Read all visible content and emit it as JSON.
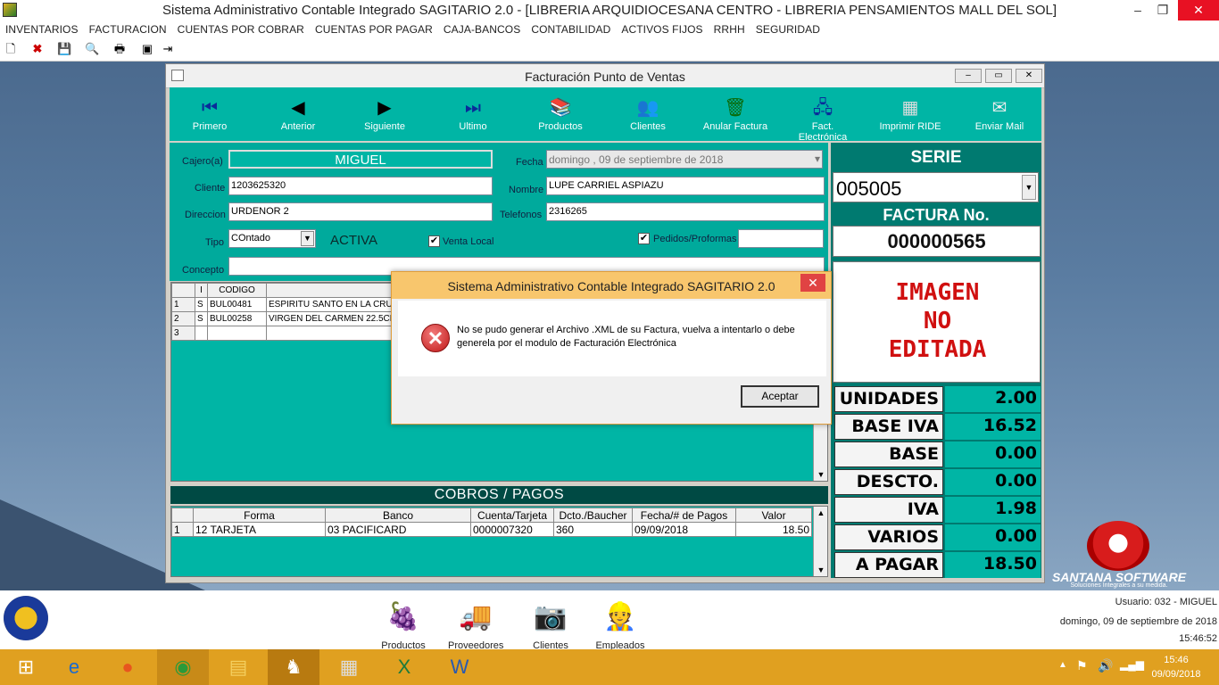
{
  "app": {
    "title": "Sistema Administrativo Contable Integrado SAGITARIO 2.0 - [LIBRERIA ARQUIDIOCESANA CENTRO - LIBRERIA PENSAMIENTOS MALL DEL SOL]",
    "minimize": "–",
    "restore": "❐",
    "close": "✕"
  },
  "menu": [
    "INVENTARIOS",
    "FACTURACION",
    "CUENTAS POR COBRAR",
    "CUENTAS POR PAGAR",
    "CAJA-BANCOS",
    "CONTABILIDAD",
    "ACTIVOS FIJOS",
    "RRHH",
    "SEGURIDAD"
  ],
  "child": {
    "title": "Facturación Punto de Ventas"
  },
  "nav": [
    {
      "label": "Primero",
      "icon": "first-icon",
      "glyph": "⏮"
    },
    {
      "label": "Anterior",
      "icon": "prev-icon",
      "glyph": "◀"
    },
    {
      "label": "Siguiente",
      "icon": "next-icon",
      "glyph": "▶"
    },
    {
      "label": "Ultimo",
      "icon": "last-icon",
      "glyph": "⏭"
    },
    {
      "label": "Productos",
      "icon": "books-icon",
      "glyph": "📚"
    },
    {
      "label": "Clientes",
      "icon": "people-icon",
      "glyph": "👥"
    },
    {
      "label": "Anular Factura",
      "icon": "trash-icon",
      "glyph": "🗑"
    },
    {
      "label": "Fact. Electrónica",
      "icon": "network-icon",
      "glyph": "🖧"
    },
    {
      "label": "Imprimir RIDE",
      "icon": "print-icon",
      "glyph": "▦"
    },
    {
      "label": "Enviar Mail",
      "icon": "mail-icon",
      "glyph": "✉"
    }
  ],
  "form": {
    "cajero_label": "Cajero(a)",
    "cajero": "MIGUEL",
    "fecha_label": "Fecha",
    "fecha": "domingo , 09 de septiembre de 2018",
    "cliente_label": "Cliente",
    "cliente": "1203625320",
    "nombre_label": "Nombre",
    "nombre": "LUPE CARRIEL ASPIAZU",
    "direccion_label": "Direccion",
    "direccion": "URDENOR 2",
    "telefonos_label": "Telefonos",
    "telefonos": "2316265",
    "tipo_label": "Tipo",
    "tipo": "COntado",
    "estado": "ACTIVA",
    "venta_local": "Venta Local",
    "pedidos": "Pedidos/Proformas",
    "concepto_label": "Concepto"
  },
  "items": {
    "headers": [
      "",
      "I",
      "CODIGO",
      ""
    ],
    "rows": [
      [
        "1",
        "S",
        "BUL00481",
        "ESPIRITU SANTO EN LA CRU"
      ],
      [
        "2",
        "S",
        "BUL00258",
        "VIRGEN DEL CARMEN 22.5CM"
      ],
      [
        "3",
        "",
        "",
        ""
      ]
    ]
  },
  "cobros": {
    "title": "COBROS  /  PAGOS",
    "headers": [
      "",
      "Forma",
      "Banco",
      "Cuenta/Tarjeta",
      "Dcto./Baucher",
      "Fecha/# de Pagos",
      "Valor"
    ],
    "rows": [
      [
        "1",
        "12 TARJETA",
        "03 PACIFICARD",
        "0000007320",
        "360",
        "09/09/2018",
        "18.50"
      ]
    ]
  },
  "right": {
    "serie_label": "SERIE",
    "serie": "005005",
    "factura_label": "FACTURA No.",
    "factura": "000000565",
    "imagen": [
      "IMAGEN",
      "NO",
      "EDITADA"
    ],
    "totals": [
      {
        "k": "UNIDADES",
        "v": "2.00"
      },
      {
        "k": "BASE IVA",
        "v": "16.52"
      },
      {
        "k": "BASE CERO",
        "v": "0.00"
      },
      {
        "k": "DESCTO.",
        "v": "0.00"
      },
      {
        "k": "IVA",
        "v": "1.98"
      },
      {
        "k": "VARIOS",
        "v": "0.00"
      },
      {
        "k": "A PAGAR",
        "v": "18.50"
      }
    ]
  },
  "dialog": {
    "title": "Sistema Administrativo Contable Integrado SAGITARIO 2.0",
    "message": "No se pudo generar el Archivo .XML de su Factura, vuelva a intentarlo o debe generela por el modulo de Facturación Electrónica",
    "ok": "Aceptar",
    "close": "✕"
  },
  "dock": [
    {
      "label": "Productos",
      "icon": "raspberry-icon",
      "glyph": "🍇"
    },
    {
      "label": "Proveedores",
      "icon": "truck-icon",
      "glyph": "🚚"
    },
    {
      "label": "Clientes",
      "icon": "webcam-icon",
      "glyph": "📷"
    },
    {
      "label": "Empleados",
      "icon": "worker-icon",
      "glyph": "👷"
    }
  ],
  "status": {
    "usuario": "Usuario:  032 - MIGUEL",
    "fecha": "domingo, 09 de septiembre de 2018",
    "hora": "15:46:52"
  },
  "brand": {
    "name": "SANTANA SOFTWARE",
    "tagline": "Soluciones Integrales a su medida."
  },
  "taskbar": {
    "time": "15:46",
    "date": "09/09/2018"
  },
  "colors": {
    "teal": "#00b5a5",
    "dark_teal": "#007a70",
    "taskbar": "#e0a020",
    "accent_red": "#d01010"
  }
}
